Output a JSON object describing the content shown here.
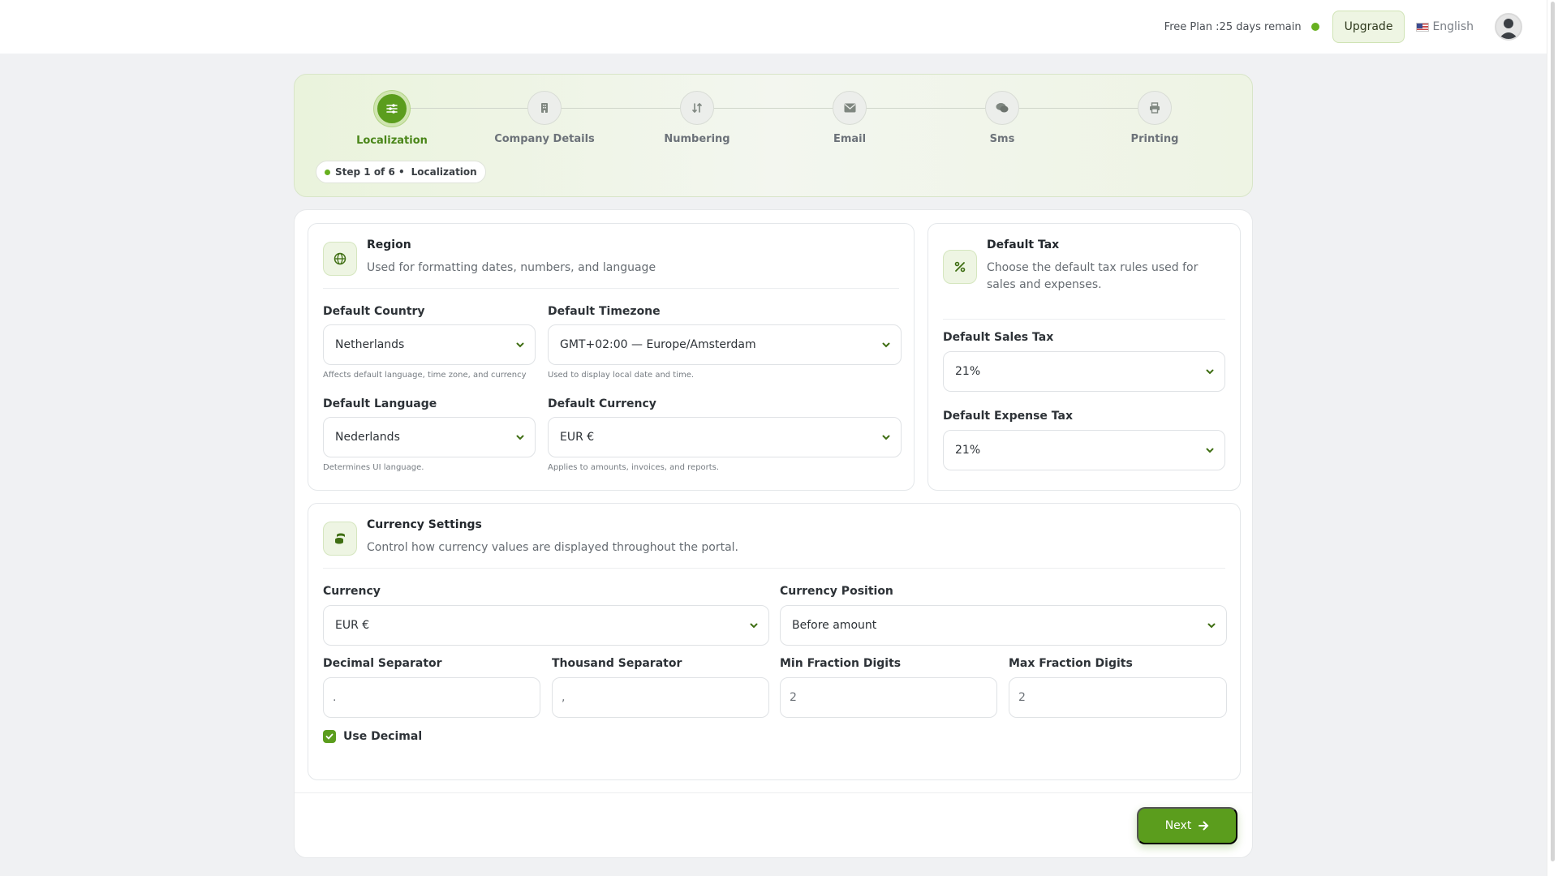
{
  "header": {
    "plan_text": "Free Plan :25 days remain",
    "upgrade_label": "Upgrade",
    "language": "English"
  },
  "stepper": {
    "steps": [
      {
        "label": "Localization",
        "icon": "sliders-icon",
        "active": true
      },
      {
        "label": "Company Details",
        "icon": "building-icon",
        "active": false
      },
      {
        "label": "Numbering",
        "icon": "sort-numbers-icon",
        "active": false
      },
      {
        "label": "Email",
        "icon": "envelope-icon",
        "active": false
      },
      {
        "label": "Sms",
        "icon": "chat-bubbles-icon",
        "active": false
      },
      {
        "label": "Printing",
        "icon": "printer-icon",
        "active": false
      }
    ],
    "badge": {
      "step_text": "Step 1 of 6 •",
      "current": "Localization"
    }
  },
  "region": {
    "title": "Region",
    "subtitle": "Used for formatting dates, numbers, and language",
    "country": {
      "label": "Default Country",
      "value": "Netherlands",
      "hint": "Affects default language, time zone, and currency"
    },
    "timezone": {
      "label": "Default Timezone",
      "value": "GMT+02:00 — Europe/Amsterdam",
      "hint": "Used to display local date and time."
    },
    "language": {
      "label": "Default Language",
      "value": "Nederlands",
      "hint": "Determines UI language."
    },
    "currency": {
      "label": "Default Currency",
      "value": "EUR €",
      "hint": "Applies to amounts, invoices, and reports."
    }
  },
  "tax": {
    "title": "Default Tax",
    "subtitle": "Choose the default tax rules used for sales and expenses.",
    "sales": {
      "label": "Default Sales Tax",
      "value": "21%"
    },
    "expense": {
      "label": "Default Expense Tax",
      "value": "21%"
    }
  },
  "currency_settings": {
    "title": "Currency Settings",
    "subtitle": "Control how currency values are displayed throughout the portal.",
    "currency": {
      "label": "Currency",
      "value": "EUR €"
    },
    "position": {
      "label": "Currency Position",
      "value": "Before amount"
    },
    "decimal_separator": {
      "label": "Decimal Separator",
      "value": "."
    },
    "thousand_separator": {
      "label": "Thousand Separator",
      "value": ","
    },
    "min_fraction": {
      "label": "Min Fraction Digits",
      "value": "2"
    },
    "max_fraction": {
      "label": "Max Fraction Digits",
      "value": "2"
    },
    "use_decimal": {
      "label": "Use Decimal",
      "checked": true
    }
  },
  "footer": {
    "next_label": "Next"
  },
  "colors": {
    "accent": "#5b9d1d",
    "accent_light": "#eef5e3",
    "status_dot": "#67b01f"
  }
}
